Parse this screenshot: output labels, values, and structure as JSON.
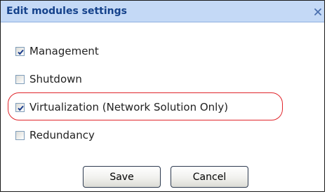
{
  "dialog": {
    "title": "Edit modules settings",
    "close_icon": "close-x-icon"
  },
  "options": [
    {
      "label": "Management",
      "checked": true
    },
    {
      "label": "Shutdown",
      "checked": false
    },
    {
      "label": "Virtualization (Network Solution Only)",
      "checked": true
    },
    {
      "label": "Redundancy",
      "checked": false
    }
  ],
  "buttons": {
    "save_label": "Save",
    "cancel_label": "Cancel"
  },
  "colors": {
    "title_bar": "#c4d9f6",
    "title_text": "#15428b",
    "highlight_ring": "#e0252b",
    "checkmark": "#1a3c8c"
  }
}
